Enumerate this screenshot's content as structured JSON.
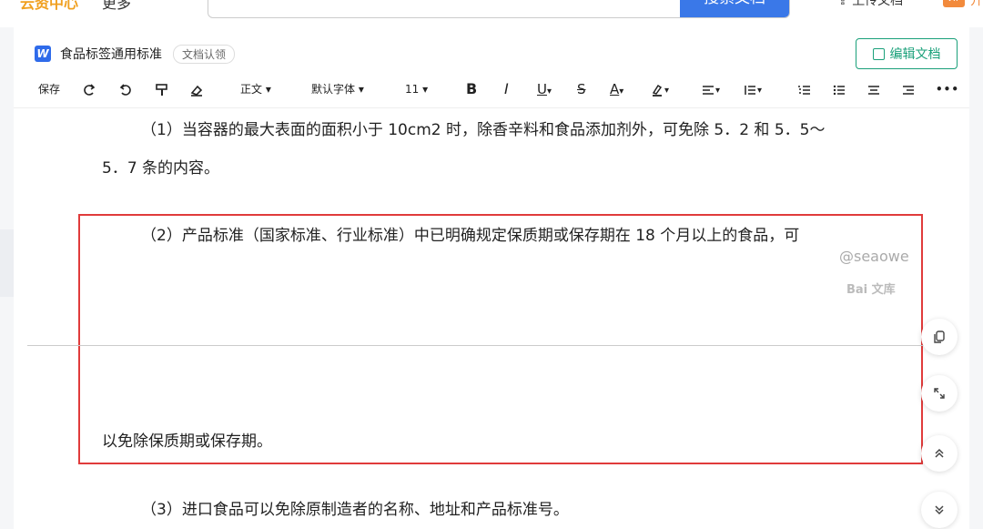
{
  "topbar": {
    "nav_left": "云资中心",
    "nav_more": "更多",
    "search_button": "搜索文档",
    "upload": "上传文档",
    "vip_badge": "VIP",
    "vip_text": "开"
  },
  "doc": {
    "title": "食品标签通用标准",
    "claim_badge": "文档认领",
    "edit_button": "编辑文档"
  },
  "toolbar": {
    "save": "保存",
    "style": "正文",
    "font": "默认字体",
    "size": "11",
    "bold": "B",
    "italic": "I",
    "underline": "U",
    "strike": "S",
    "font_color": "A",
    "more": "•••"
  },
  "content": {
    "p1_line1": "（1）当容器的最大表面的面积小于 10cm2 时，除香辛料和食品添加剂外，可免除 5．2 和 5．5～",
    "p1_line2": "5．7 条的内容。",
    "p2_line1": "（2）产品标准（国家标准、行业标准）中已明确规定保质期或保存期在 18 个月以上的食品，可",
    "p2_line2": "以免除保质期或保存期。",
    "p3_line1": "（3）进口食品可以免除原制造者的名称、地址和产品标准号。"
  },
  "watermark": {
    "handle": "@seaowe",
    "brand": "Bai 文库"
  },
  "colors": {
    "accent_blue": "#3a78e8",
    "edit_green": "#1aa07a",
    "highlight_red": "#e03b3b"
  }
}
